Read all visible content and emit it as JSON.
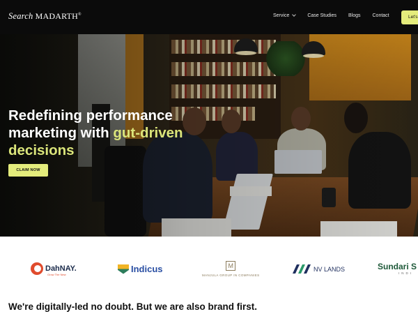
{
  "nav": {
    "logo_script": "Search",
    "logo_main": "MADARTH",
    "logo_reg": "®",
    "links": [
      "Service",
      "Case Studies",
      "Blogs",
      "Contact"
    ],
    "cta_label": "Let's",
    "chevron_icon": "chevron-down-icon"
  },
  "hero": {
    "title_line1": "Redefining performance",
    "title_line2_pre": "marketing with ",
    "title_highlight": "gut-driven",
    "title_line3": "decisions",
    "cta_label": "CLAIM NOW",
    "accent_color": "#e4ec7c"
  },
  "clients": {
    "dahnay": {
      "name": "DahNAY.",
      "tagline": "Grow The New"
    },
    "indicus": {
      "name": "Indicus"
    },
    "manjula": {
      "mark": "M",
      "name": "MANJULA GROUP IN COMPANIES"
    },
    "nvlands": {
      "name": "NV LANDS"
    },
    "sundari": {
      "name": "Sundari S",
      "sub": "INDI"
    }
  },
  "section": {
    "heading": "We're digitally-led no doubt. But we are also brand first."
  }
}
